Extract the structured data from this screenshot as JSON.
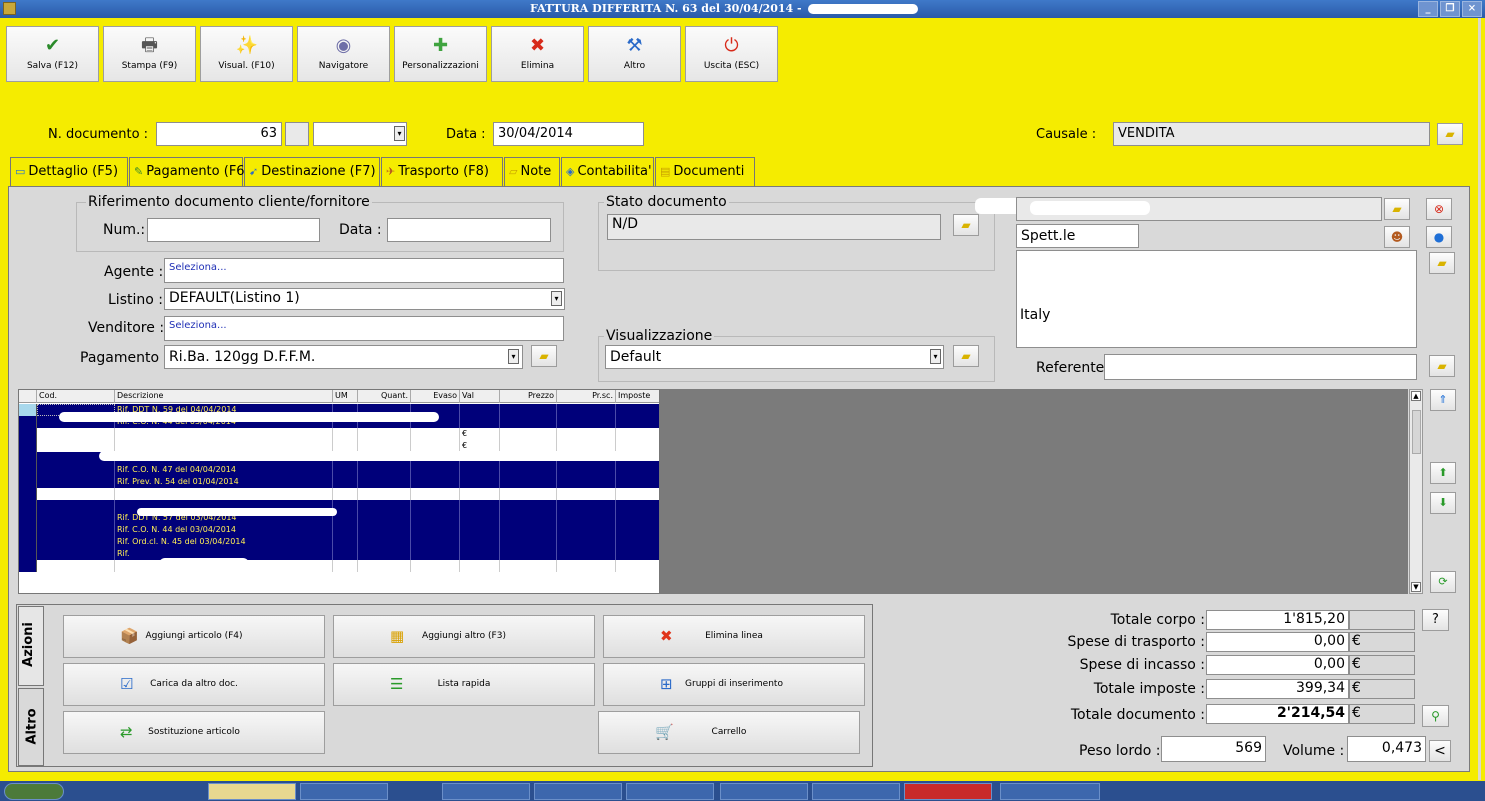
{
  "window": {
    "title": "FATTURA DIFFERITA N. 63 del 30/04/2014 -"
  },
  "toolbar": [
    {
      "label": "Salva (F12)",
      "icon": "check-icon",
      "glyph": "✔",
      "color": "#2a8a2a"
    },
    {
      "label": "Stampa (F9)",
      "icon": "printer-icon",
      "glyph": "🖶",
      "color": "#555555"
    },
    {
      "label": "Visual. (F10)",
      "icon": "magic-wand-icon",
      "glyph": "✨",
      "color": "#c8a000"
    },
    {
      "label": "Navigatore",
      "icon": "eye-icon",
      "glyph": "◉",
      "color": "#6f6fa8"
    },
    {
      "label": "Personalizzazioni",
      "icon": "puzzle-icon",
      "glyph": "✚",
      "color": "#3fa33f"
    },
    {
      "label": "Elimina",
      "icon": "delete-x-icon",
      "glyph": "✖",
      "color": "#d72a1a"
    },
    {
      "label": "Altro",
      "icon": "tools-icon",
      "glyph": "⚒",
      "color": "#2a6ac9"
    },
    {
      "label": "Uscita (ESC)",
      "icon": "exit-icon",
      "glyph": "⏻",
      "color": "#d72a1a"
    }
  ],
  "header": {
    "doc_number_label": "N. documento :",
    "doc_number": "63",
    "date_label": "Data :",
    "date": "30/04/2014",
    "causale_label": "Causale :",
    "causale": "VENDITA"
  },
  "tabs": [
    {
      "label": "Dettaglio (F5)",
      "glyph": "▭"
    },
    {
      "label": "Pagamento (F6)",
      "glyph": "✎"
    },
    {
      "label": "Destinazione (F7)",
      "glyph": "➹"
    },
    {
      "label": "Trasporto (F8)",
      "glyph": "✈"
    },
    {
      "label": "Note",
      "glyph": "▱"
    },
    {
      "label": "Contabilita'",
      "glyph": "◈"
    },
    {
      "label": "Documenti",
      "glyph": "▤"
    }
  ],
  "rif_doc": {
    "title": "Riferimento documento cliente/fornitore",
    "num_label": "Num.:",
    "num": "",
    "data_label": "Data :",
    "data": ""
  },
  "fields": {
    "agente_label": "Agente :",
    "agente": "Seleziona...",
    "listino_label": "Listino :",
    "listino": "DEFAULT(Listino 1)",
    "venditore_label": "Venditore :",
    "venditore": "Seleziona...",
    "pagamento_label": "Pagamento :",
    "pagamento": "Ri.Ba. 120gg D.F.F.M."
  },
  "stato": {
    "title": "Stato documento",
    "value": "N/D"
  },
  "visualizzazione": {
    "title": "Visualizzazione",
    "value": "Default"
  },
  "cliente": {
    "salutation": "Spett.le",
    "country": "Italy",
    "referente_label": "Referente"
  },
  "grid": {
    "columns": [
      "Cod.",
      "Descrizione",
      "UM",
      "Quant.",
      "Evaso",
      "Val",
      "Prezzo",
      "Pr.sc.",
      "Imposte"
    ],
    "rows": [
      {
        "type": "blue",
        "cod": "",
        "desc": "Rif. DDT N. 59 del 04/04/2014"
      },
      {
        "type": "blue",
        "cod": "",
        "desc": "Rif. C.O. N. 44 del 03/04/2014"
      },
      {
        "type": "white",
        "cod": "",
        "desc": "",
        "val": "€"
      },
      {
        "type": "white",
        "cod": "",
        "desc": "",
        "val": "€"
      },
      {
        "type": "blue",
        "cod": "",
        "desc": ""
      },
      {
        "type": "blue",
        "cod": "",
        "desc": "Rif. C.O. N. 47 del 04/04/2014"
      },
      {
        "type": "blue",
        "cod": "",
        "desc": "Rif. Prev. N. 54 del 01/04/2014"
      },
      {
        "type": "white",
        "cod": "",
        "desc": ""
      },
      {
        "type": "blue",
        "cod": "",
        "desc": ""
      },
      {
        "type": "blue",
        "cod": "",
        "desc": "Rif. DDT N. 57 del 03/04/2014"
      },
      {
        "type": "blue",
        "cod": "",
        "desc": "Rif. C.O. N. 44 del 03/04/2014"
      },
      {
        "type": "blue",
        "cod": "",
        "desc": "Rif. Ord.cl. N. 45 del 03/04/2014"
      },
      {
        "type": "blue",
        "cod": "",
        "desc": "Rif."
      },
      {
        "type": "white",
        "cod": "",
        "desc": ""
      }
    ]
  },
  "side_tabs": {
    "azioni": "Azioni",
    "altro": "Altro"
  },
  "actions": [
    {
      "label": "Aggiungi articolo (F4)",
      "icon": "box-add-icon",
      "glyph": "📦"
    },
    {
      "label": "Aggiungi altro (F3)",
      "icon": "grid-add-icon",
      "glyph": "▦"
    },
    {
      "label": "Elimina linea",
      "icon": "delete-x-icon",
      "glyph": "✖"
    },
    {
      "label": "Carica da altro doc.",
      "icon": "load-doc-icon",
      "glyph": "☑"
    },
    {
      "label": "Lista rapida",
      "icon": "quick-list-icon",
      "glyph": "☰"
    },
    {
      "label": "Gruppi di inserimento",
      "icon": "group-insert-icon",
      "glyph": "⊞"
    },
    {
      "label": "Sostituzione articolo",
      "icon": "replace-icon",
      "glyph": "⇄"
    },
    {
      "label": "Carrello",
      "icon": "cart-icon",
      "glyph": "🛒"
    }
  ],
  "totals": {
    "corpo_label": "Totale corpo :",
    "corpo": "1'815,20",
    "trasporto_label": "Spese di trasporto :",
    "trasporto": "0,00",
    "incasso_label": "Spese di incasso :",
    "incasso": "0,00",
    "imposte_label": "Totale imposte :",
    "imposte": "399,34",
    "documento_label": "Totale documento :",
    "documento": "2'214,54",
    "currency": "€",
    "peso_label": "Peso lordo :",
    "peso": "569",
    "volume_label": "Volume :",
    "volume": "0,473",
    "help": "?",
    "less": "<"
  }
}
